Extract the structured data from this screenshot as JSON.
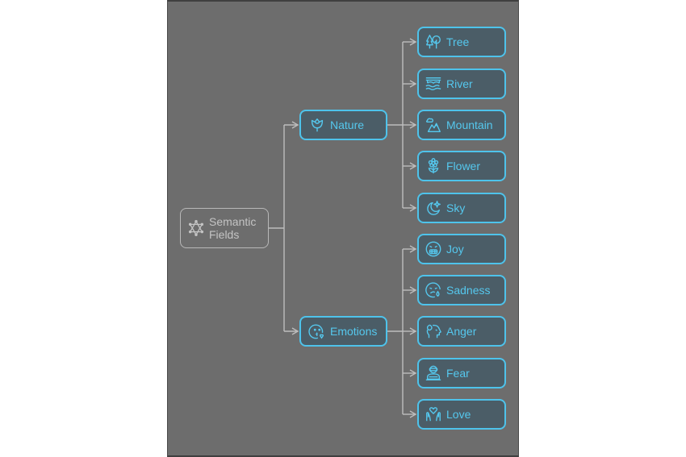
{
  "diagram": {
    "type": "mind-map",
    "colors": {
      "canvas": "#6d6d6d",
      "connector": "#bdbdbd",
      "node_border": "#4ec3eb",
      "node_fill": "#4b5d67",
      "node_text": "#55c8ee",
      "root_border": "#b8b8b8",
      "root_text": "#c4c4c4"
    },
    "root": {
      "label_line1": "Semantic",
      "label_line2": "Fields",
      "icon": "star-of-david-network-icon"
    },
    "branches": [
      {
        "label": "Nature",
        "icon": "rose-icon",
        "children": [
          {
            "label": "Tree",
            "icon": "trees-icon"
          },
          {
            "label": "River",
            "icon": "river-bridge-icon"
          },
          {
            "label": "Mountain",
            "icon": "mountain-cloud-icon"
          },
          {
            "label": "Flower",
            "icon": "flower-icon"
          },
          {
            "label": "Sky",
            "icon": "moon-stars-icon"
          }
        ]
      },
      {
        "label": "Emotions",
        "icon": "kissing-face-icon",
        "children": [
          {
            "label": "Joy",
            "icon": "grimacing-face-icon"
          },
          {
            "label": "Sadness",
            "icon": "crying-face-icon"
          },
          {
            "label": "Anger",
            "icon": "angry-head-icon"
          },
          {
            "label": "Fear",
            "icon": "person-vr-icon"
          },
          {
            "label": "Love",
            "icon": "hands-heart-icon"
          }
        ]
      }
    ]
  }
}
